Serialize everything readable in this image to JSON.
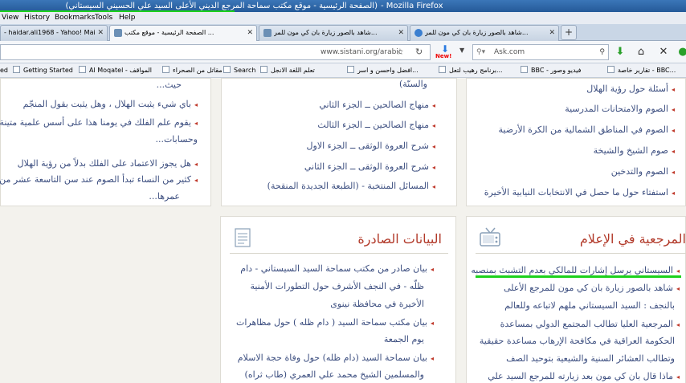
{
  "window": {
    "title": "(الصفحة الرئيسية - موقع مكتب سماحة المرجع الديني الأعلى السيد علي الحسيني السيستاني)",
    "app_suffix": "- Mozilla Firefox"
  },
  "menu": [
    "View",
    "History",
    "Bookmarks",
    "Tools",
    "Help"
  ],
  "tabs": [
    {
      "label": "- haidar.ali1968 - Yahoo! Mail",
      "active": false
    },
    {
      "label": "الصفحة الرئيسية - موقع مكتب ...",
      "active": true
    },
    {
      "label": "شاهد بالصور زيارة بان كي مون للمر...",
      "active": false
    },
    {
      "label": "شاهد بالصور زيارة بان كي مون للمر...",
      "active": false
    }
  ],
  "nav": {
    "url": "www.sistani.org/arabic",
    "download_badge": "New!",
    "search_placeholder": "Ask.com"
  },
  "bookmarks": [
    "ed",
    "Getting Started",
    "Al Moqatel - المواقف",
    "مقاتل من الصحراء",
    "Search",
    "تعلم اللغة الانجل",
    "افضل واحسن و اسر...",
    "برنامج رهيب لتعل...",
    "BBC - فيديو وصور",
    "تقارير خاصة - BBC..."
  ],
  "left_panel": {
    "items": [
      {
        "text": "حيث...",
        "bullet": false
      },
      {
        "text": "باي شيء يثبت الهلال ، وهل يثبت بقول المنجّم ",
        "bullet": true
      },
      {
        "text": "يقوم علم الفلك في يومنا هذا على أسس علمية متينة ",
        "bullet": true
      },
      {
        "text": "وحسابات...",
        "bullet": false
      },
      {
        "text": "هل يجوز الاعتماد على الفلك بدلاً من رؤية الهلال",
        "bullet": true
      },
      {
        "text": "كثير من النساء تبدأ الصوم عند سن التاسعة عشر من ",
        "bullet": true
      },
      {
        "text": "عمرها...",
        "bullet": false
      }
    ]
  },
  "middle_panel": {
    "items": [
      {
        "text": "والسنّة)",
        "bullet": false
      },
      {
        "text": "منهاج الصالحين ــ الجزء الثاني",
        "bullet": true
      },
      {
        "text": "منهاج الصالحين ــ الجزء الثالث",
        "bullet": true
      },
      {
        "text": "شرح العروة الوثقى ــ الجزء الاول",
        "bullet": true
      },
      {
        "text": "شرح العروة الوثقى ــ الجزء الثاني",
        "bullet": true
      },
      {
        "text": "المسائل المنتخبة - (الطبعة الجديدة المنقحة)",
        "bullet": true
      }
    ]
  },
  "right_panel": {
    "items": [
      {
        "text": "أسئلة حول رؤية الهلال",
        "bullet": true
      },
      {
        "text": "الصوم والامتحانات المدرسية",
        "bullet": true
      },
      {
        "text": "الصوم في المناطق الشمالية من الكرة الأرضية",
        "bullet": true
      },
      {
        "text": "صوم الشيخ والشيخة",
        "bullet": true
      },
      {
        "text": "الصوم والتدخين",
        "bullet": true
      },
      {
        "text": "استفتاء حول ما حصل في الانتخابات النيابية الأخيرة",
        "bullet": true
      }
    ]
  },
  "statements_panel": {
    "title": "البيانات الصادرة",
    "items": [
      {
        "text": "بيان صادر من مكتب سماحة السيد السيستاني - دام ",
        "bullet": true
      },
      {
        "text": "ظلّه - في النجف الأشرف حول التطورات الأمنية",
        "bullet": false
      },
      {
        "text": "الأخيرة في محافظة نينوى",
        "bullet": false
      },
      {
        "text": "بيان مكتب سماحة السيد ( دام ظله ) حول مظاهرات ",
        "bullet": true
      },
      {
        "text": "يوم الجمعة",
        "bullet": false
      },
      {
        "text": "بيان سماحة السيد (دام ظله) حول وفاة حجة الاسلام ",
        "bullet": true
      },
      {
        "text": "والمسلمين الشيخ محمد علي العمري (طاب ثراه)",
        "bullet": false
      }
    ]
  },
  "media_panel": {
    "title": "المرجعية في الإعلام",
    "items": [
      {
        "text": "السيستاني يرسل إشارات للمالكي بعدم التشبث بمنصبه",
        "bullet": true
      },
      {
        "text": "شاهد بالصور زيارة بان كي مون للمرجع الأعلى ",
        "bullet": true
      },
      {
        "text": "بالنجف : السيد السيستاني ملهم لاتباعه وللعالم",
        "bullet": false
      },
      {
        "text": "المرجعية العليا تطالب المجتمع الدولي بمساعدة",
        "bullet": true
      },
      {
        "text": "الحكومة العراقية في مكافحة الإرهاب مساعدة حقيقية",
        "bullet": false
      },
      {
        "text": "وتطالب العشائر السنية والشيعية بتوحيد الصف",
        "bullet": false
      },
      {
        "text": "ماذا قال بان كي مون بعد زيارته للمرجع السيد علي ",
        "bullet": true
      }
    ]
  }
}
